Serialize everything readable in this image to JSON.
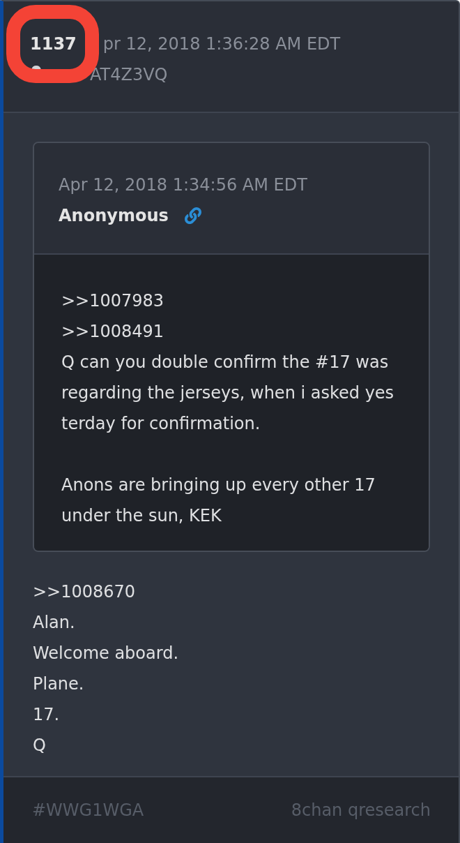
{
  "post_header": {
    "number": "1137",
    "number_circled": true,
    "date": "pr 12, 2018 1:36:28 AM EDT",
    "id": "AT4Z3VQ"
  },
  "quoted_post": {
    "date": "Apr 12, 2018 1:34:56 AM EDT",
    "author": "Anonymous",
    "paragraphs": [
      [
        ">>1007983",
        ">>1008491",
        "Q can you double confirm the #17 was",
        "regarding the jerseys, when i asked yes",
        "terday for confirmation."
      ],
      [
        "Anons are bringing up every other 17",
        "under the sun, KEK"
      ]
    ]
  },
  "post_body": {
    "lines": [
      ">>1008670",
      "Alan.",
      "Welcome aboard.",
      "Plane.",
      "17.",
      "Q"
    ]
  },
  "footer": {
    "hashtag": "#WWG1WGA",
    "source": "8chan qresearch"
  }
}
